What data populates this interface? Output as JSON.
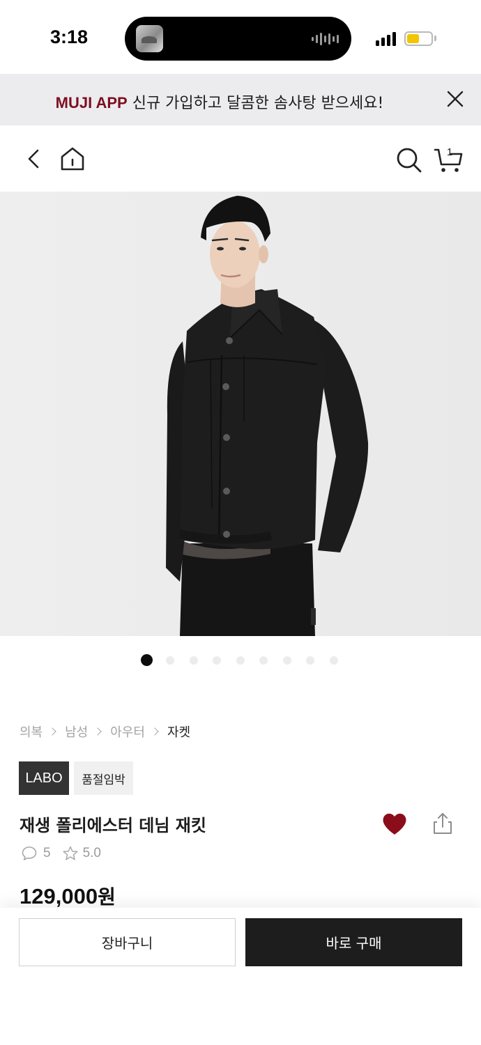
{
  "status_bar": {
    "time": "3:18"
  },
  "promo_banner": {
    "brand": "MUJI APP",
    "message": " 신규 가입하고 달콤한 솜사탕 받으세요!"
  },
  "header": {
    "cart_count": "1"
  },
  "gallery": {
    "total_images": 9,
    "active_index": 0
  },
  "breadcrumb": [
    "의복",
    "남성",
    "아우터",
    "자켓"
  ],
  "product": {
    "badges": [
      "LABO",
      "품절임박"
    ],
    "title": "재생 폴리에스터 데님 재킷",
    "review_count": "5",
    "rating": "5.0",
    "price": "129,000",
    "price_unit": "원",
    "wishlisted": true
  },
  "actions": {
    "cart_label": "장바구니",
    "buy_label": "바로 구매"
  },
  "colors": {
    "brand_red": "#7d0f1f",
    "wish_red": "#8b0d1a",
    "buy_button": "#1d1d1d"
  },
  "icons": [
    "close-icon",
    "back-chevron-icon",
    "home-icon",
    "search-icon",
    "cart-icon",
    "heart-icon",
    "share-icon",
    "comment-icon",
    "star-icon"
  ]
}
